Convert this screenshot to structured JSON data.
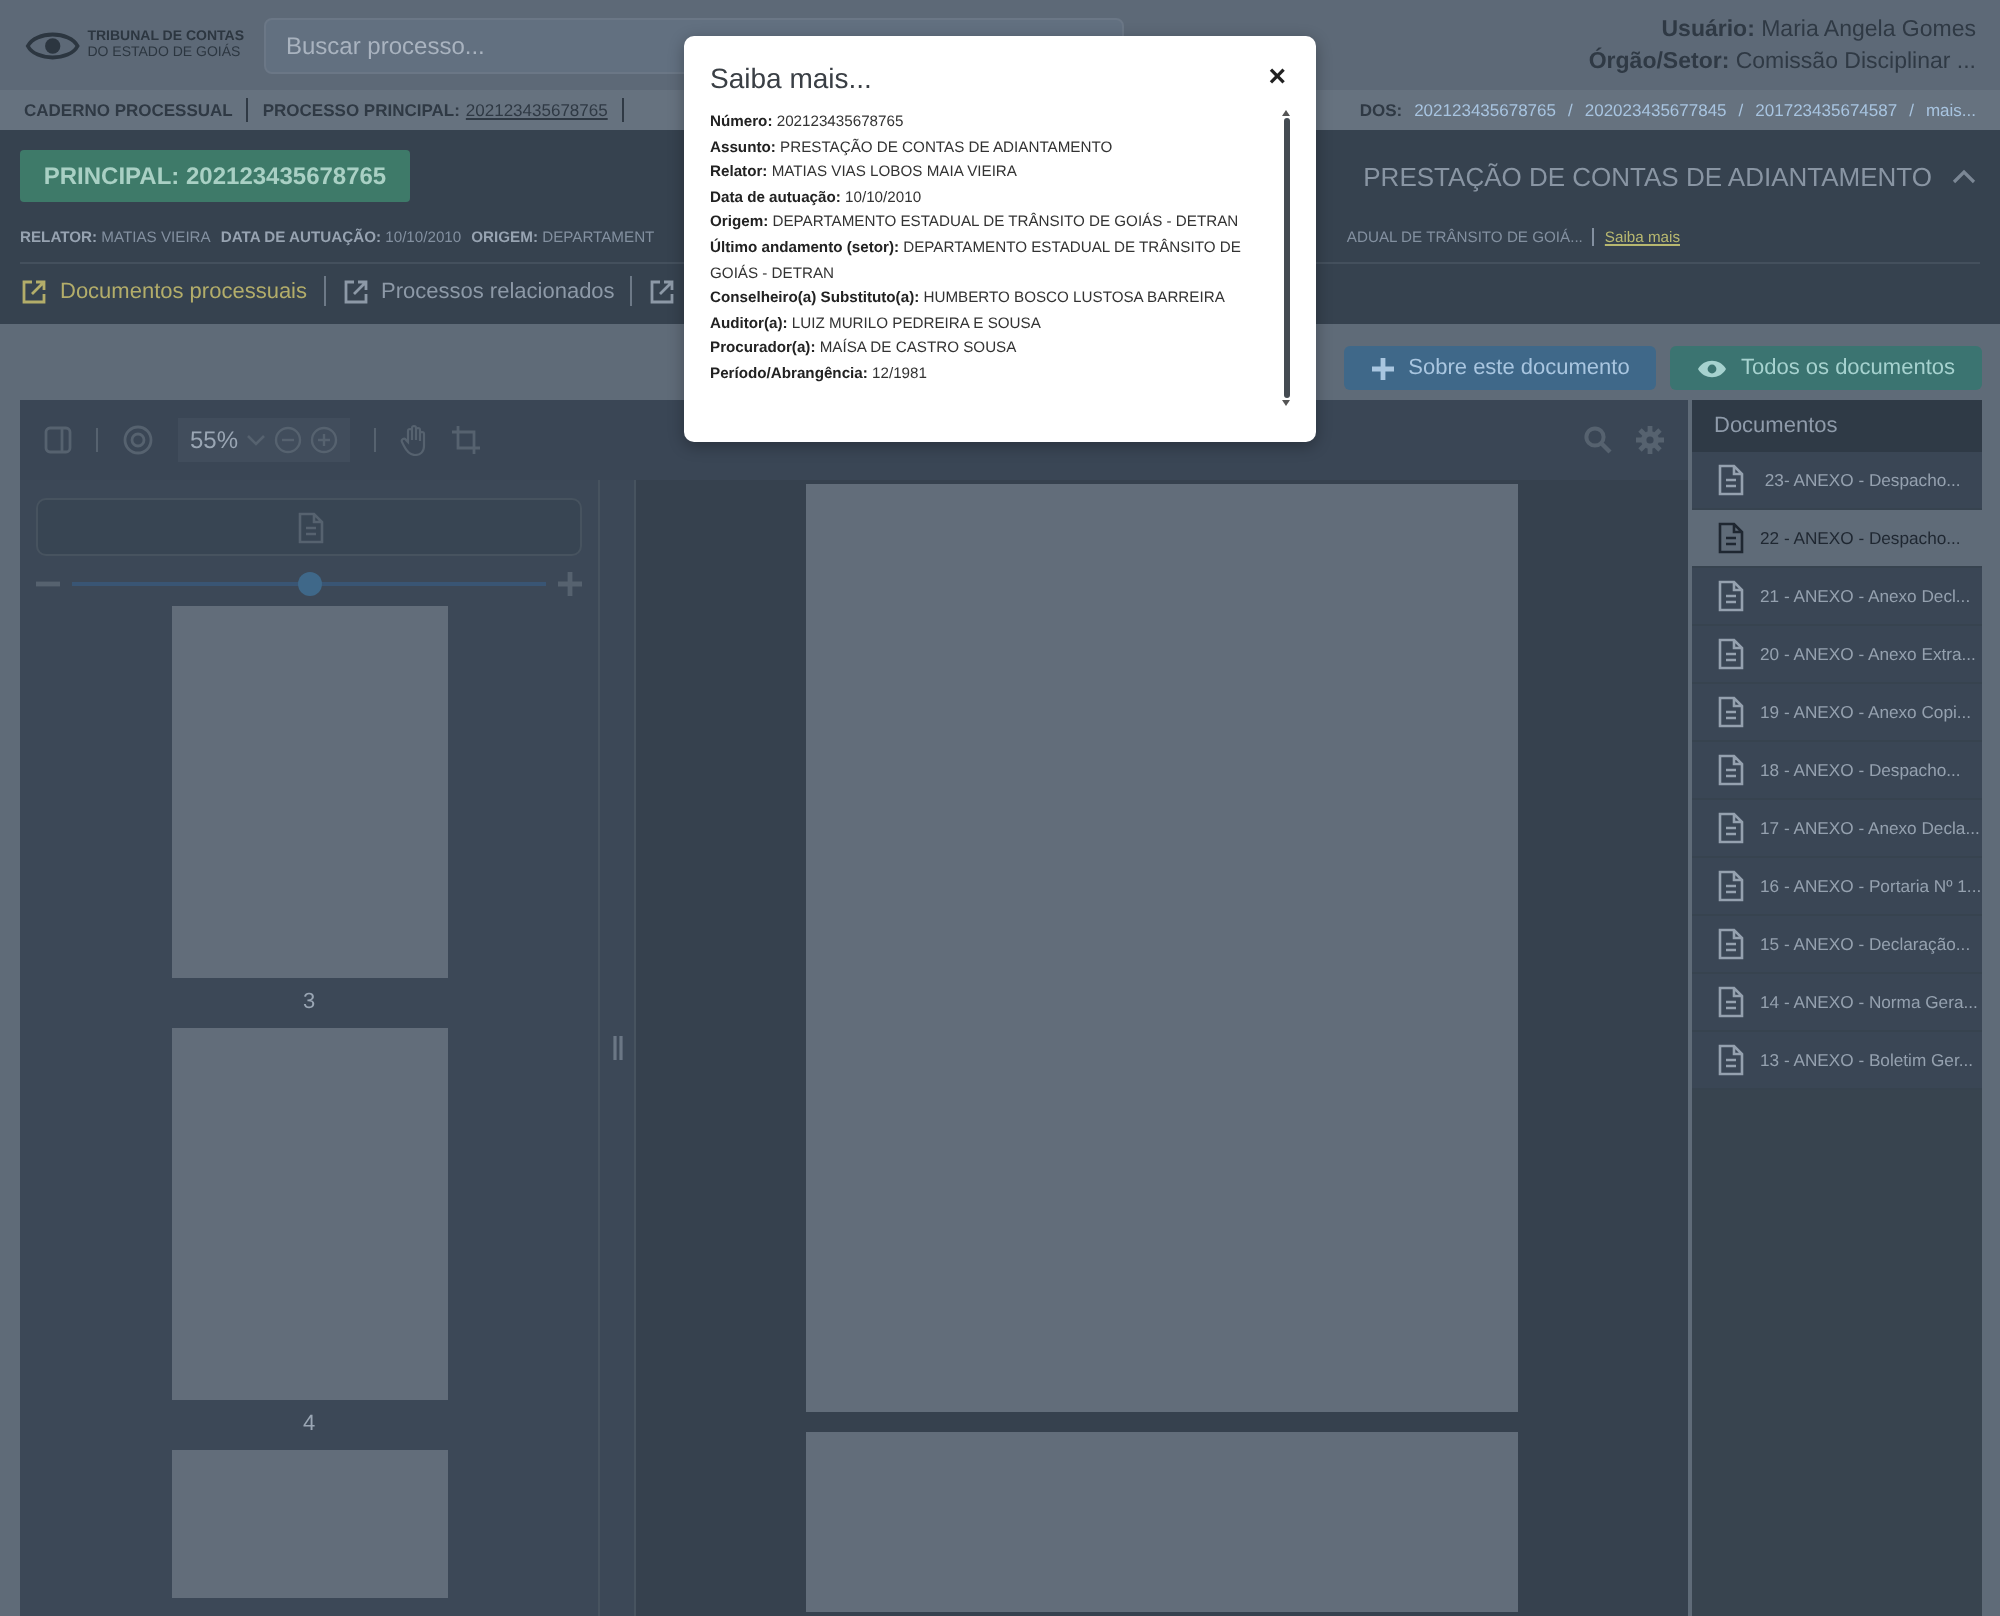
{
  "header": {
    "logo_lines": [
      "TRIBUNAL DE CONTAS",
      "DO ESTADO DE GOIÁS"
    ],
    "search": {
      "placeholder": "Buscar processo..."
    },
    "user": [
      {
        "label": "Usuário:",
        "value": "Maria Angela Gomes"
      },
      {
        "label": "Órgão/Setor:",
        "value": "Comissão Disciplinar ..."
      }
    ]
  },
  "breadcrumb": {
    "left": [
      {
        "label": "CADERNO PROCESSUAL"
      },
      {
        "label": "PROCESSO PRINCIPAL:",
        "link": "202123435678765"
      }
    ],
    "right_label": "DOS:",
    "separator": "/",
    "links": [
      "202123435678765",
      "202023435677845",
      "201723435674587",
      "mais..."
    ]
  },
  "process": {
    "principal_button": "PRINCIPAL: 202123435678765",
    "title": "PRESTAÇÃO DE CONTAS DE ADIANTAMENTO",
    "expanded": true,
    "info_left": [
      {
        "label": "RELATOR:",
        "value": "MATIAS VIEIRA"
      },
      {
        "label": "DATA DE AUTUAÇÃO:",
        "value": "10/10/2010"
      },
      {
        "label": "ORIGEM:",
        "value": "DEPARTAMENT"
      }
    ],
    "info_right": "ADUAL DE TRÂNSITO DE GOIÁ...",
    "more_link": "Saiba mais",
    "tabs": [
      {
        "label": "Documentos processuais",
        "selected": true
      },
      {
        "label": "Processos relacionados",
        "selected": false
      },
      {
        "selected": false
      }
    ]
  },
  "actions": [
    {
      "kind": "add",
      "label": "Sobre este documento"
    },
    {
      "kind": "view",
      "label": "Todos os documentos"
    }
  ],
  "viewer": {
    "zoom": "55%",
    "thumb_slider": {
      "level": 0.5
    },
    "thumbnails": [
      {
        "page": "3"
      },
      {
        "page": "4"
      }
    ]
  },
  "documents": {
    "title": "Documentos",
    "items": [
      {
        "label": " 23- ANEXO - Despacho...",
        "selected": false
      },
      {
        "label": "22 - ANEXO - Despacho...",
        "selected": true
      },
      {
        "label": "21 - ANEXO - Anexo Decl...",
        "selected": false
      },
      {
        "label": "20 - ANEXO - Anexo Extra...",
        "selected": false
      },
      {
        "label": "19 - ANEXO - Anexo Copi...",
        "selected": false
      },
      {
        "label": "18 - ANEXO - Despacho...",
        "selected": false
      },
      {
        "label": "17 - ANEXO - Anexo Decla...",
        "selected": false
      },
      {
        "label": "16 - ANEXO - Portaria Nº 1...",
        "selected": false
      },
      {
        "label": "15 - ANEXO - Declaração...",
        "selected": false
      },
      {
        "label": "14 - ANEXO - Norma Gera...",
        "selected": false
      },
      {
        "label": "13 - ANEXO - Boletim Ger...",
        "selected": false
      }
    ]
  },
  "modal": {
    "title": "Saiba mais...",
    "close": "×",
    "fields": [
      {
        "label": "Número:",
        "value": "202123435678765"
      },
      {
        "label": "Assunto:",
        "value": "PRESTAÇÃO DE CONTAS DE ADIANTAMENTO"
      },
      {
        "label": "Relator:",
        "value": "MATIAS VIAS LOBOS MAIA VIEIRA"
      },
      {
        "label": "Data de autuação:",
        "value": " 10/10/2010"
      },
      {
        "label": "Origem:",
        "value": "DEPARTAMENTO ESTADUAL DE TRÂNSITO DE GOIÁS - DETRAN"
      },
      {
        "label": "Último andamento (setor):",
        "value": "DEPARTAMENTO ESTADUAL DE TRÂNSITO DE GOIÁS - DETRAN"
      },
      {
        "label": "Conselheiro(a) Substituto(a):",
        "value": "HUMBERTO BOSCO LUSTOSA BARREIRA"
      },
      {
        "label": "Auditor(a):",
        "value": "LUIZ MURILO PEDREIRA E SOUSA"
      },
      {
        "label": "Procurador(a):",
        "value": "MAÍSA DE CASTRO SOUSA"
      },
      {
        "label": "Período/Abrangência:",
        "value": "12/1981"
      }
    ]
  }
}
